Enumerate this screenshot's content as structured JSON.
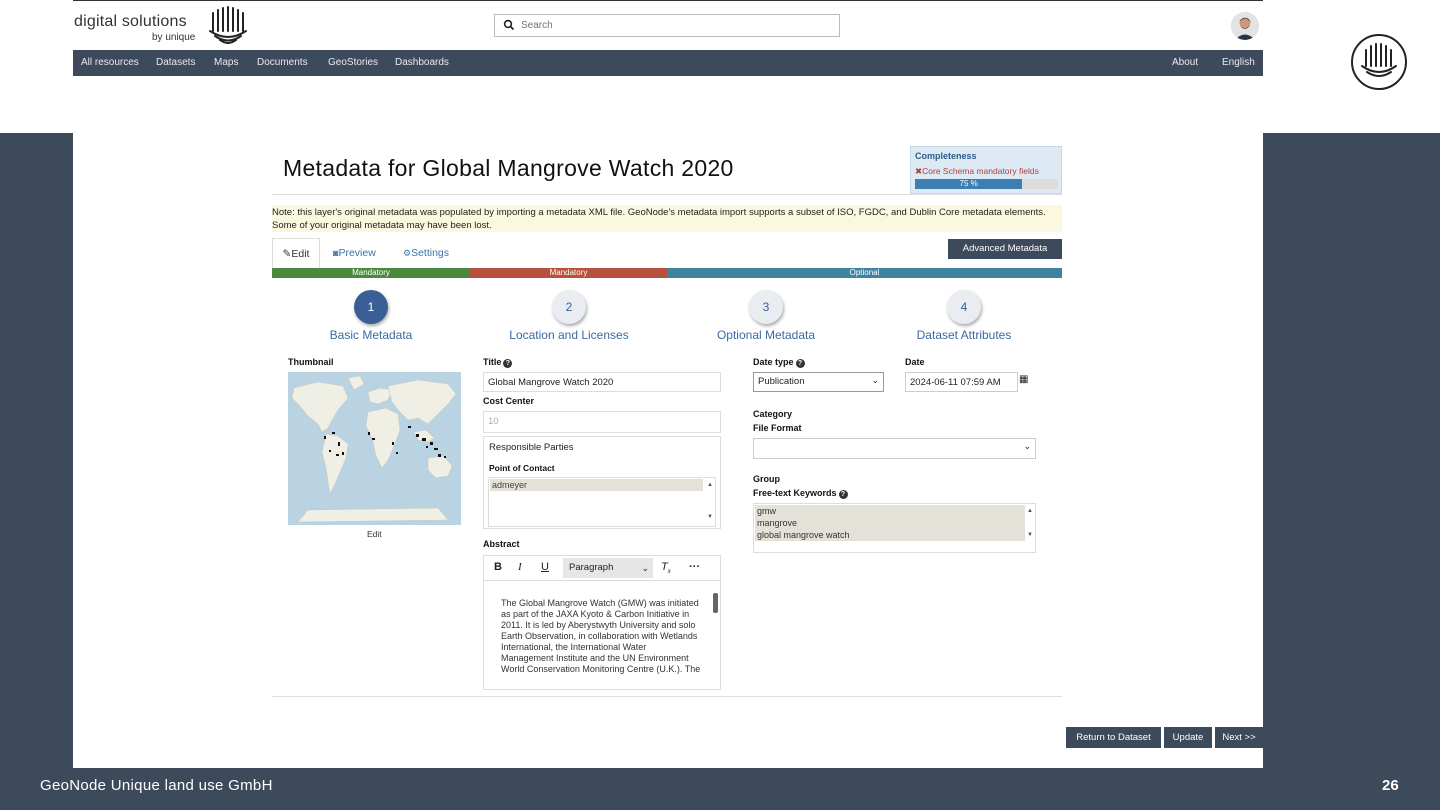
{
  "header": {
    "brand": "digital solutions",
    "brand_sub": "by unique",
    "search_placeholder": "Search"
  },
  "nav": {
    "items": [
      "All resources",
      "Datasets",
      "Maps",
      "Documents",
      "GeoStories",
      "Dashboards"
    ],
    "right": [
      "About",
      "English"
    ]
  },
  "page": {
    "title": "Metadata for Global Mangrove Watch 2020",
    "completeness": {
      "title": "Completeness",
      "item": "Core Schema mandatory fields",
      "percent": 75,
      "percent_label": "75 %"
    },
    "note": "Note: this layer's original metadata was populated by importing a metadata XML file. GeoNode's metadata import supports a subset of ISO, FGDC, and Dublin Core metadata elements. Some of your original metadata may have been lost.",
    "tabs": [
      "Edit",
      "Preview",
      "Settings"
    ],
    "advanced_button": "Advanced Metadata",
    "bars": [
      "Mandatory",
      "Mandatory",
      "Optional"
    ],
    "steps": [
      {
        "num": "1",
        "label": "Basic Metadata"
      },
      {
        "num": "2",
        "label": "Location and Licenses"
      },
      {
        "num": "3",
        "label": "Optional Metadata"
      },
      {
        "num": "4",
        "label": "Dataset Attributes"
      }
    ]
  },
  "form": {
    "thumbnail_label": "Thumbnail",
    "thumbnail_edit": "Edit",
    "title_label": "Title",
    "title_value": "Global Mangrove Watch 2020",
    "cost_center_label": "Cost Center",
    "cost_center_placeholder": "10",
    "responsible_label": "Responsible Parties",
    "point_of_contact_label": "Point of Contact",
    "point_of_contact_value": "admeyer",
    "abstract_label": "Abstract",
    "editor_format": "Paragraph",
    "abstract_text": "The Global Mangrove Watch (GMW) was initiated as part of the JAXA Kyoto & Carbon Initiative in 2011. It is led by Aberystwyth University and solo Earth Observation, in collaboration with Wetlands International, the International Water Management Institute and the UN Environment World Conservation Monitoring Centre (U.K.). The",
    "date_type_label": "Date type",
    "date_type_value": "Publication",
    "date_label": "Date",
    "date_value": "2024-06-11 07:59 AM",
    "category_label": "Category",
    "file_format_label": "File Format",
    "group_label": "Group",
    "keywords_label": "Free-text Keywords",
    "keywords": [
      "gmw",
      "mangrove",
      "global mangrove watch"
    ]
  },
  "actions": [
    "Return to Dataset",
    "Update",
    "Next >>"
  ],
  "footer": {
    "left": "GeoNode Unique land use GmbH",
    "page_number": "26"
  }
}
